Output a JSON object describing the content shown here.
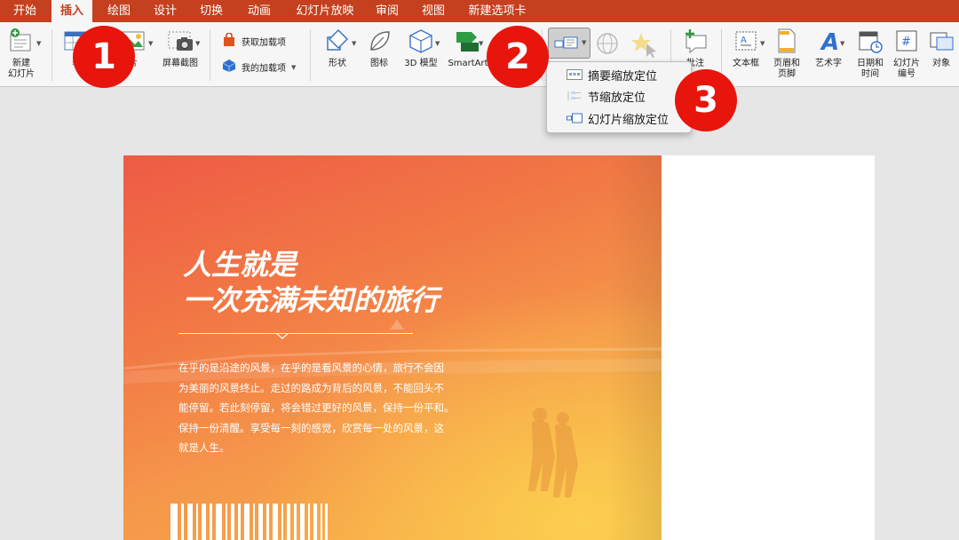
{
  "tabs": [
    {
      "label": "开始",
      "active": false
    },
    {
      "label": "插入",
      "active": true
    },
    {
      "label": "绘图",
      "active": false
    },
    {
      "label": "设计",
      "active": false
    },
    {
      "label": "切换",
      "active": false
    },
    {
      "label": "动画",
      "active": false
    },
    {
      "label": "幻灯片放映",
      "active": false
    },
    {
      "label": "审阅",
      "active": false
    },
    {
      "label": "视图",
      "active": false
    },
    {
      "label": "新建选项卡",
      "active": false
    }
  ],
  "ribbon": {
    "new_slide": {
      "line1": "新建",
      "line2": "幻灯片",
      "icon": "new-slide-icon"
    },
    "table": {
      "label": "表",
      "icon": "table-icon"
    },
    "picture": {
      "label": "片",
      "icon": "picture-icon"
    },
    "screenshot": {
      "label": "屏幕截图",
      "icon": "camera-icon"
    },
    "get_addins": {
      "label": "获取加载项",
      "icon": "store-bag-icon"
    },
    "my_addins": {
      "label": "我的加载项",
      "icon": "addin-cube-icon"
    },
    "shapes": {
      "label": "形状",
      "icon": "shapes-icon"
    },
    "icons": {
      "label": "图标",
      "icon": "leaf-icon"
    },
    "model3d": {
      "label": "3D 模型",
      "icon": "cube-icon"
    },
    "smartart": {
      "label": "SmartArt",
      "icon": "smartart-icon"
    },
    "zoom": {
      "icon": "zoom-icon"
    },
    "link": {
      "icon": "link-globe-icon"
    },
    "action": {
      "icon": "action-star-icon"
    },
    "comment": {
      "label": "批注",
      "icon": "add-comment-icon"
    },
    "textbox": {
      "label": "文本框",
      "icon": "textbox-icon"
    },
    "header_footer": {
      "line1": "页眉和",
      "line2": "页脚",
      "icon": "header-footer-icon"
    },
    "wordart": {
      "label": "艺术字",
      "icon": "wordart-icon"
    },
    "datetime": {
      "line1": "日期和",
      "line2": "时间",
      "icon": "calendar-icon"
    },
    "slide_number": {
      "line1": "幻灯片",
      "line2": "编号",
      "icon": "hash-icon"
    },
    "object": {
      "label": "对象",
      "icon": "object-icon"
    }
  },
  "dropdown": {
    "items": [
      {
        "label": "摘要缩放定位",
        "icon": "summary-zoom-icon"
      },
      {
        "label": "节缩放定位",
        "icon": "section-zoom-icon"
      },
      {
        "label": "幻灯片缩放定位",
        "icon": "slide-zoom-icon"
      }
    ]
  },
  "badges": [
    "1",
    "2",
    "3"
  ],
  "slide": {
    "headline_line1": "人生就是",
    "headline_line2": "一次充满未知的旅行",
    "body_lines": [
      "在乎的是沿途的风景，在乎的是看风景的心情，旅行不会因",
      "为美丽的风景终止。走过的路成为背后的风景，不能回头不",
      "能停留。若此刻停留，将会错过更好的风景，保持一份平和。",
      "保持一份清醒。享受每一刻的感觉，欣赏每一处的风景，这",
      "就是人生。"
    ]
  },
  "colors": {
    "accent": "#c5401e",
    "badge": "#e8150d",
    "slide_gradient_start": "#ee5a45",
    "slide_gradient_end": "#f8b548"
  }
}
